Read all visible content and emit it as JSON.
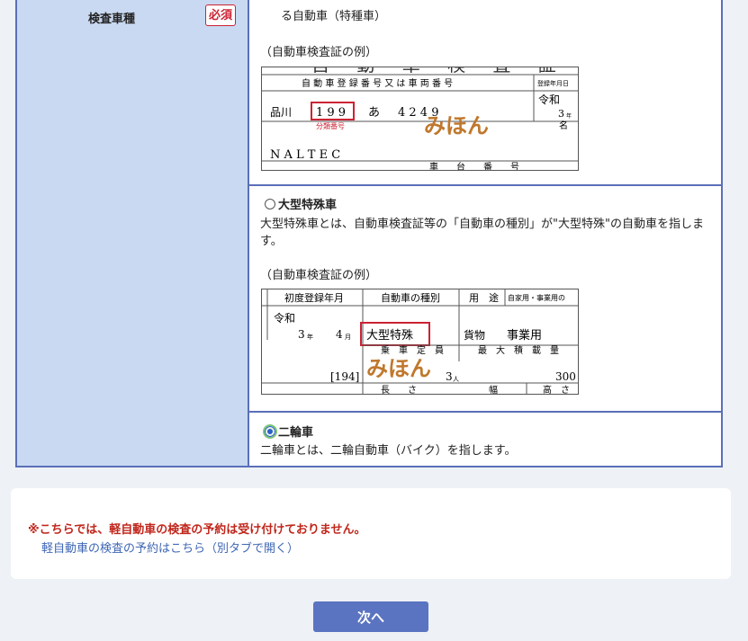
{
  "form": {
    "label": "検査車種",
    "required_badge": "必須",
    "option_special": {
      "desc_tail": "る自動車（特種車）",
      "example_caption": "（自動車検査証の例）",
      "cert": {
        "title_frag": "自 動 車 検 査 証",
        "header": "自 動 車 登 録 番 号 又 は 車 両 番 号",
        "right_header": "登録年月日",
        "plate_area": "品川",
        "plate_class": "1 9 9",
        "plate_kana": "あ",
        "plate_number": "4 2 4 9",
        "class_note": "分類番号",
        "era": "令和",
        "era_year": "3",
        "year_unit": "年",
        "name_label": "名",
        "owner": "N A L T E C",
        "footer": "車　　台　　番　　号",
        "watermark": "みほん"
      }
    },
    "option_large": {
      "label": "大型特殊車",
      "selected": false,
      "description": "大型特殊車とは、自動車検査証等の「自動車の種別」が\"大型特殊\"の自動車を指します。",
      "example_caption": "（自動車検査証の例）",
      "cert": {
        "col1": "初度登録年月",
        "col2": "自動車の種別",
        "col3": "用　途",
        "col4": "自家用・事業用の",
        "era": "令和",
        "year": "3",
        "year_unit": "年",
        "month": "4",
        "month_unit": "月",
        "kind": "大型特殊",
        "use": "貨物",
        "business": "事業用",
        "capacity_label": "乗　車　定　員",
        "max_load_label": "最　大　積　載　量",
        "code": "[194]",
        "persons": "3",
        "persons_unit": "人",
        "load_value": "300",
        "length": "長　　さ",
        "width": "幅",
        "height": "高　さ",
        "watermark": "みほん"
      }
    },
    "option_motorcycle": {
      "label": "二輪車",
      "selected": true,
      "description": "二輪車とは、二輪自動車（バイク）を指します。"
    }
  },
  "notice": {
    "warning": "※こちらでは、軽自動車の検査の予約は受け付けておりません。",
    "link": "軽自動車の検査の予約はこちら（別タブで開く）"
  },
  "next_button": "次へ"
}
